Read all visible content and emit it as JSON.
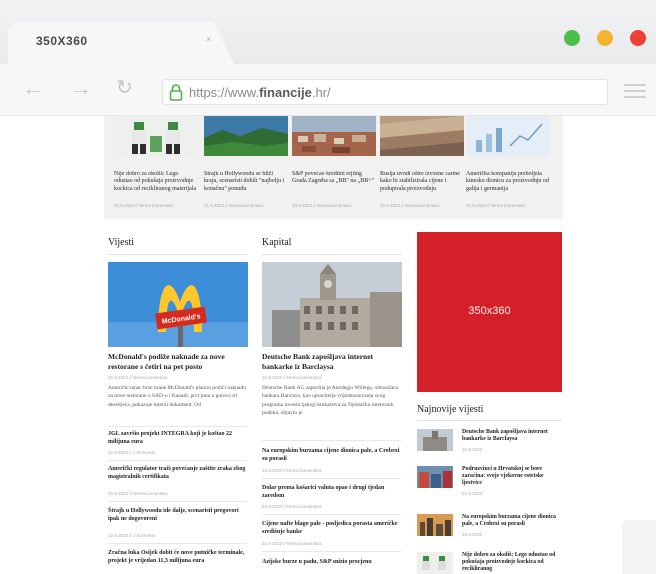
{
  "browser": {
    "tab_title": "350X360",
    "tab_close": "×",
    "url_prefix": "https://www.",
    "url_domain": "financije",
    "url_suffix": ".hr/",
    "dot_colors": [
      "#4bbf47",
      "#f5b332",
      "#ee4136"
    ]
  },
  "strip": [
    {
      "title": "Nije dobro za okoliš: Lego odustao od pokušaja proizvodnje kockica od recikliranog materijala",
      "meta": "22.9.2023 // Nema komentara"
    },
    {
      "title": "Štrajk u Hollywoodu se bliži kraju, scenaristi dobili \"najbolju i konačnu\" ponudu",
      "meta": "21.9.2023 // Nema komentara"
    },
    {
      "title": "S&P povećao kreditni rejting Grada Zagreba sa „BB\" na „BB+\"",
      "meta": "20.9.2023 // Nema komentara"
    },
    {
      "title": "Rusija uvodi oštre izvozne carine kako bi stabilizirala cijene i podupirala proizvodnju",
      "meta": "22.9.2023 // Nema komentara"
    },
    {
      "title": "Američka kompanija preboljela kinesku dionicu za proizvodnju od galija i germanija",
      "meta": "21.9.2023 // Nema komentara"
    }
  ],
  "vijesti": {
    "heading": "Vijesti",
    "main_title": "McDonald's podiže naknade za nove restorane s četiri na pet posto",
    "main_meta": "22.9.2023 // Nema komentara",
    "main_excerpt": "Američki lanac brze hrane McDonald's planira podići naknadu za nove restorane u SAD-u i Kanadi, prvi puta u gotovo tri desetljeća, pokazuje interni dokument. Od",
    "items": [
      {
        "title": "JGL završio projekt INTEGRA koji je koštao 22 milijuna eura",
        "meta": "22.9.2023 // 1 komentar"
      },
      {
        "title": "Američki regulator traži povećanje zaštite zraka zbog magistralnih certifikata",
        "meta": "22.9.2023 // Nema komentara"
      },
      {
        "title": "Štrajk u Hollywoodu ide dalje, scenaristi pregovori ipak ne dogovoreni",
        "meta": "22.9.2023 // 1 komentar"
      },
      {
        "title": "Zračna luka Osijek dobit će nove putničke terminale, projekt je vrijedan 11,3 milijuna eura",
        "meta": ""
      }
    ]
  },
  "kapital": {
    "heading": "Kapital",
    "main_title": "Deutsche Bank zapošljava internet bankarke iz Barclaysa",
    "main_meta": "22.9.2023 // Nema komentara",
    "main_excerpt": "Deutsche Bank AG zaposlila je Anedegju Willega, odnosilaca bankara Barclays, kao upravitelja vrijednosnicama svog programa investicijskog bankarstva za Njemačku interesnih podeka, objavio je",
    "items": [
      {
        "title": "Na europskim burzama cijene dionica pale, a Crobexi su porasli",
        "meta": "22.9.2023 // Nema komentara"
      },
      {
        "title": "Dolar prema košarici valuta opao i drugi tjedan zaredom",
        "meta": "22.9.2023 // Nema komentara"
      },
      {
        "title": "Cijene nafte blago pale - posljedica porasta američke središnje banke",
        "meta": "22.9.2023 // Nema komentara"
      },
      {
        "title": "Azijske burze u padu, S&P snizio procjenu",
        "meta": ""
      }
    ]
  },
  "ad": {
    "label": "350x360"
  },
  "najnovije": {
    "heading": "Najnovije vijesti",
    "items": [
      {
        "title": "Deutsche Bank zapošljava internet bankarke iz Barclaysa",
        "meta": "22.9.2023"
      },
      {
        "title": "Podruzvinci u Hrvatskoj se bore zaraćina: svoje vjekovne estetske ljestvice",
        "meta": "22.9.2023"
      },
      {
        "title": "Na europskim burzama cijene dionica pale, a Crobexi su porasli",
        "meta": "22.9.2023"
      },
      {
        "title": "Nije dobro za okoliš: Lego odustao od pokušaja proizvodnje kockica od recikliranog",
        "meta": ""
      }
    ]
  }
}
